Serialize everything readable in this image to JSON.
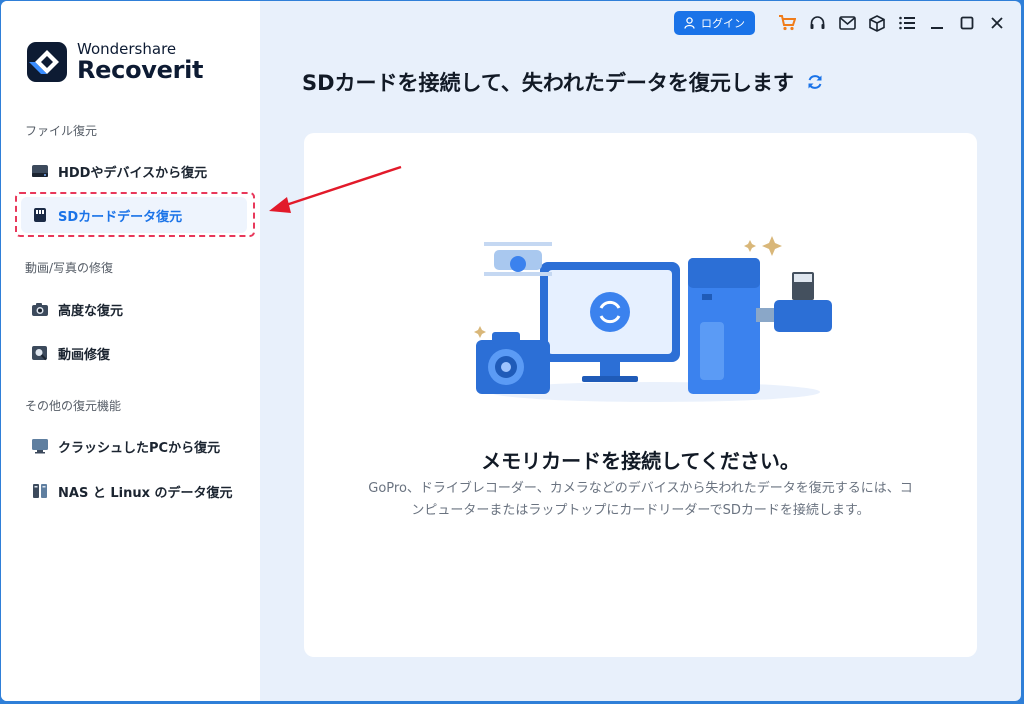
{
  "app": {
    "brand": "Wondershare",
    "product": "Recoverit"
  },
  "sidebar": {
    "sections": [
      {
        "label": "ファイル復元",
        "items": [
          {
            "label": "HDDやデバイスから復元",
            "icon": "hdd-icon"
          },
          {
            "label": "SDカードデータ復元",
            "icon": "sd-card-icon",
            "active": true
          }
        ]
      },
      {
        "label": "動画/写真の修復",
        "items": [
          {
            "label": "高度な復元",
            "icon": "camera-icon"
          },
          {
            "label": "動画修復",
            "icon": "video-repair-icon"
          }
        ]
      },
      {
        "label": "その他の復元機能",
        "items": [
          {
            "label": "クラッシュしたPCから復元",
            "icon": "monitor-icon"
          },
          {
            "label": "NAS と Linux のデータ復元",
            "icon": "nas-icon"
          }
        ]
      }
    ]
  },
  "topbar": {
    "login_label": "ログイン",
    "icons": [
      "cart-icon",
      "headset-icon",
      "mail-icon",
      "cube-icon",
      "menu-icon",
      "minimize-icon",
      "maximize-icon",
      "close-icon"
    ]
  },
  "main": {
    "title": "SDカードを接続して、失われたデータを復元します",
    "card": {
      "heading": "メモリカードを接続してください。",
      "description": "GoPro、ドライブレコーダー、カメラなどのデバイスから失われたデータを復元するには、コンピューターまたはラップトップにカードリーダーでSDカードを接続します。"
    }
  },
  "colors": {
    "accent": "#1a73e8",
    "highlight": "#e8385a",
    "cart": "#f07c1a"
  }
}
